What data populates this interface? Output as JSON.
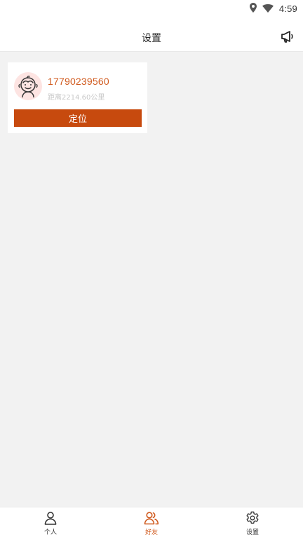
{
  "status_bar": {
    "time": "4:59",
    "icons": [
      "location-pin-icon",
      "wifi-icon"
    ]
  },
  "header": {
    "title": "设置",
    "action_icon": "megaphone-icon"
  },
  "friends": [
    {
      "avatar_icon": "baby-face-avatar-icon",
      "phone": "17790239560",
      "distance": "距离2214.60公里",
      "locate_label": "定位"
    }
  ],
  "bottom_nav": {
    "items": [
      {
        "label": "个人",
        "icon": "person-icon",
        "active": false
      },
      {
        "label": "好友",
        "icon": "friends-icon",
        "active": true
      },
      {
        "label": "设置",
        "icon": "gear-icon",
        "active": false
      }
    ]
  },
  "colors": {
    "accent": "#d05a1e",
    "button": "#c74a0e",
    "background": "#f2f2f2",
    "avatar_bg": "#fde4e2"
  }
}
